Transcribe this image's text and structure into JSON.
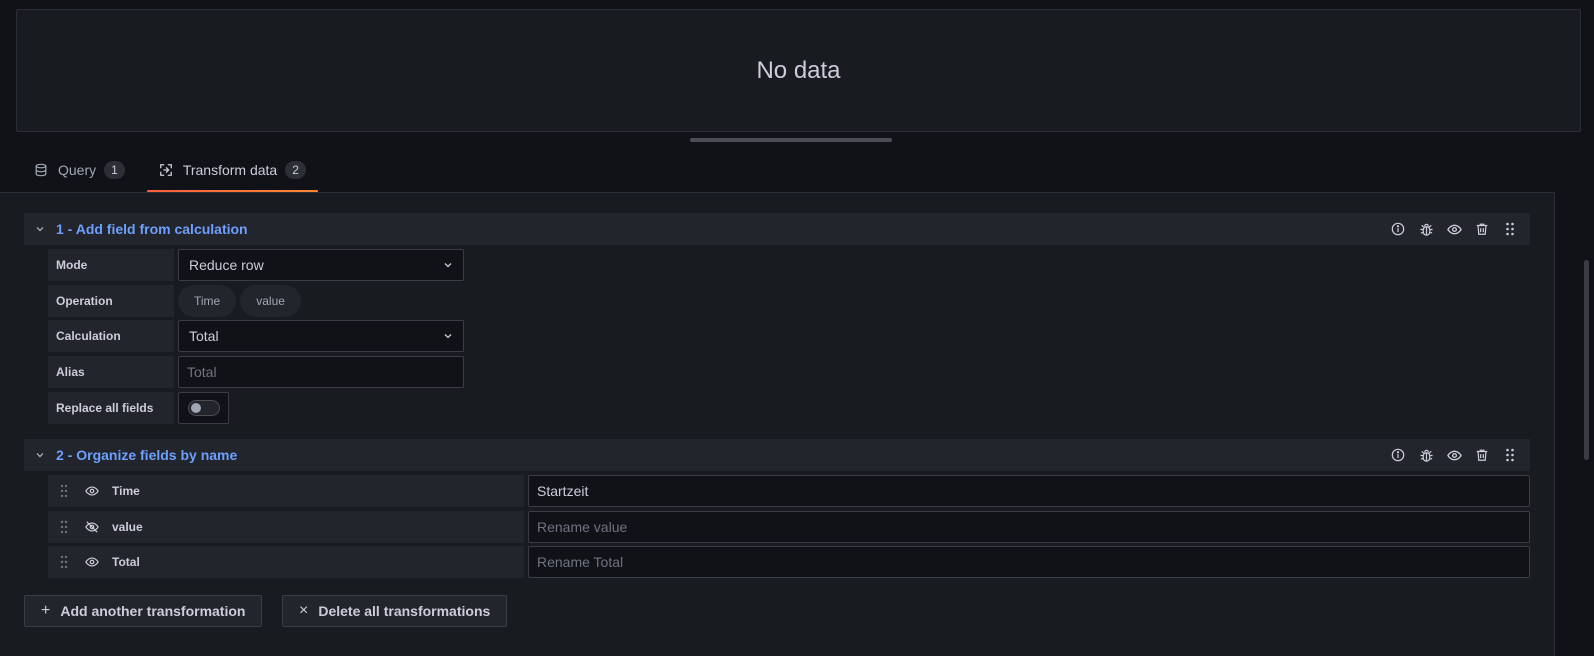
{
  "preview": {
    "message": "No data"
  },
  "tabs": [
    {
      "label": "Query",
      "count": "1"
    },
    {
      "label": "Transform data",
      "count": "2"
    }
  ],
  "transform1": {
    "title": "1 - Add field from calculation",
    "fields": {
      "mode_label": "Mode",
      "mode_value": "Reduce row",
      "operation_label": "Operation",
      "operation_pills": [
        "Time",
        "value"
      ],
      "calculation_label": "Calculation",
      "calculation_value": "Total",
      "alias_label": "Alias",
      "alias_placeholder": "Total",
      "replace_label": "Replace all fields"
    }
  },
  "transform2": {
    "title": "2 - Organize fields by name",
    "rows": [
      {
        "name": "Time",
        "rename_value": "Startzeit",
        "rename_placeholder": ""
      },
      {
        "name": "value",
        "rename_value": "",
        "rename_placeholder": "Rename value"
      },
      {
        "name": "Total",
        "rename_value": "",
        "rename_placeholder": "Rename Total"
      }
    ]
  },
  "actions": {
    "add_label": "Add another transformation",
    "delete_label": "Delete all transformations"
  }
}
